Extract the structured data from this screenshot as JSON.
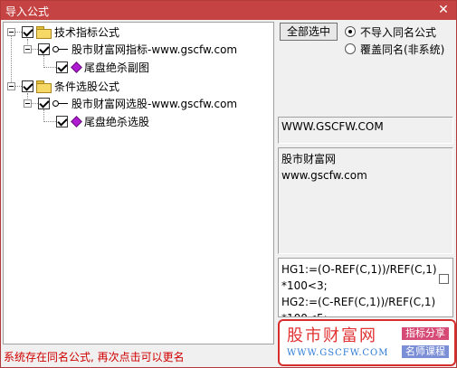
{
  "window": {
    "title": "导入公式",
    "close_glyph": "✕"
  },
  "tree": {
    "groups": [
      {
        "label": "技术指标公式",
        "child": {
          "label": "股市财富网指标-www.gscfw.com",
          "leaf": "尾盘绝杀副图"
        }
      },
      {
        "label": "条件选股公式",
        "child": {
          "label": "股市财富网选股-www.gscfw.com",
          "leaf": "尾盘绝杀选股"
        }
      }
    ]
  },
  "actions": {
    "select_all_label": "全部选中"
  },
  "options": {
    "radio1": "不导入同名公式",
    "radio2": "覆盖同名(非系统)"
  },
  "info": {
    "url": "WWW.GSCFW.COM",
    "desc_line1": "股市财富网",
    "desc_line2": "www.gscfw.com"
  },
  "code": {
    "lines": [
      "HG1:=(O-REF(C,1))/REF(C,1)",
      "*100<3;",
      "HG2:=(C-REF(C,1))/REF(C,1)",
      "*100<5;"
    ]
  },
  "status": {
    "text": "系统存在同名公式, 再次点击可以更名"
  },
  "banner": {
    "title": "股市财富网",
    "url": "WWW.GSCFW.COM",
    "tag1": "指标分享",
    "tag2": "名师课程"
  },
  "colors": {
    "titlebar": "#c54342",
    "status": "#d00000",
    "banner_border": "#d72d2d"
  }
}
